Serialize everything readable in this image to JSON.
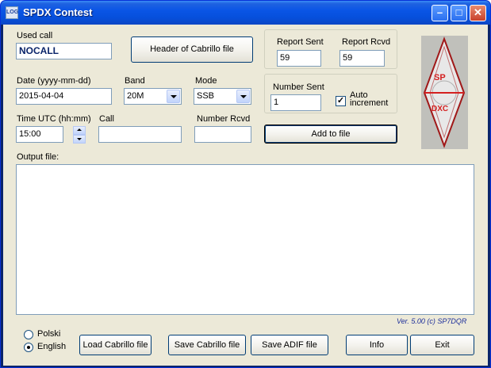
{
  "window": {
    "title": "SPDX Contest",
    "icon_text": "LOG"
  },
  "used_call": {
    "label": "Used call",
    "value": "NOCALL"
  },
  "header_button": "Header of Cabrillo file",
  "report": {
    "sent_label": "Report Sent",
    "rcvd_label": "Report Rcvd",
    "sent_value": "59",
    "rcvd_value": "59"
  },
  "date": {
    "label": "Date (yyyy-mm-dd)",
    "value": "2015-04-04"
  },
  "band": {
    "label": "Band",
    "value": "20M"
  },
  "mode": {
    "label": "Mode",
    "value": "SSB"
  },
  "number_sent": {
    "label": "Number Sent",
    "value": "1"
  },
  "auto_increment": {
    "label_line1": "Auto",
    "label_line2": "increment",
    "checked": true
  },
  "time": {
    "label": "Time UTC (hh:mm)",
    "value": "15:00"
  },
  "call": {
    "label": "Call",
    "value": ""
  },
  "number_rcvd": {
    "label": "Number Rcvd",
    "value": ""
  },
  "add_button": "Add to file",
  "output": {
    "label": "Output file:",
    "content": ""
  },
  "version": "Ver. 5.00 (c) SP7DQR",
  "language": {
    "polski": "Polski",
    "english": "English",
    "selected": "english"
  },
  "buttons": {
    "load_cabrillo": "Load Cabrillo file",
    "save_cabrillo": "Save Cabrillo file",
    "save_adif": "Save ADIF file",
    "info": "Info",
    "exit": "Exit"
  },
  "logo": {
    "top": "SP",
    "bottom": "DXC"
  },
  "colors": {
    "titlebar": "#0a55e6",
    "call_text": "#0a246a",
    "version_text": "#1c2e9a",
    "logo_red": "#d42020"
  }
}
